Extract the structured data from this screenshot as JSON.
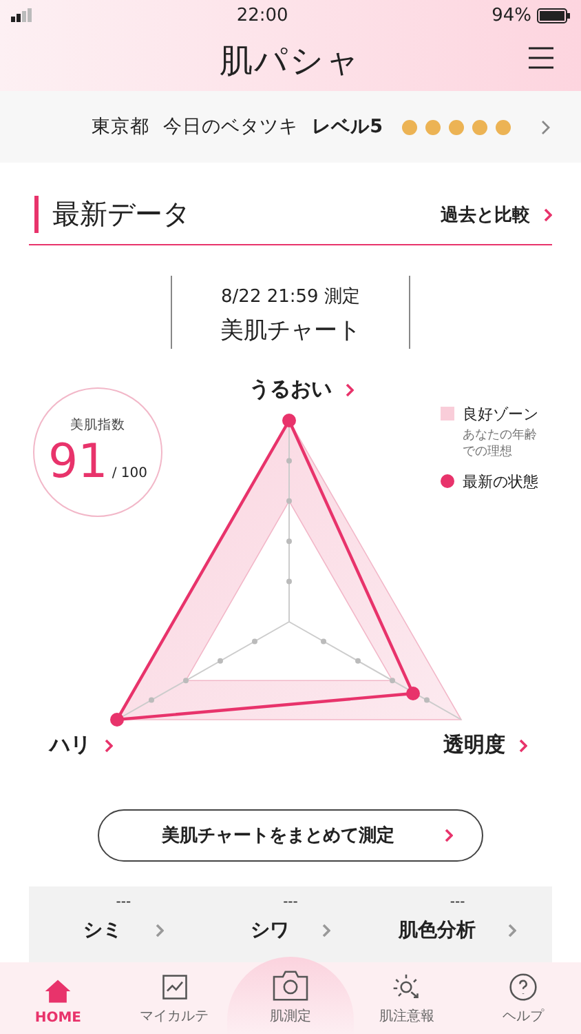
{
  "status_bar": {
    "time": "22:00",
    "battery": "94%"
  },
  "header": {
    "logo": "肌パシャ"
  },
  "weather": {
    "region": "東京都",
    "label": "今日のベタツキ",
    "level": "レベル5",
    "stars": 5
  },
  "section": {
    "title": "最新データ",
    "link": "過去と比較"
  },
  "measurement": {
    "date": "8/22 21:59 測定",
    "title": "美肌チャート"
  },
  "score": {
    "label": "美肌指数",
    "value": "91",
    "max": "/ 100"
  },
  "chart": {
    "axes": [
      "うるおい",
      "透明度",
      "ハリ"
    ],
    "legend": [
      {
        "kind": "zone",
        "label": "良好ゾーン",
        "note": "あなたの年齢での理想"
      },
      {
        "kind": "dot",
        "label": "最新の状態"
      }
    ]
  },
  "measure_button": "美肌チャートをまとめて測定",
  "cards": [
    {
      "value": "---",
      "label": "シミ"
    },
    {
      "value": "---",
      "label": "シワ"
    },
    {
      "value": "---",
      "label": "肌色分析"
    }
  ],
  "tabs": [
    {
      "label": "HOME",
      "selected": true
    },
    {
      "label": "マイカルテ",
      "selected": false
    },
    {
      "label": "肌測定",
      "selected": false
    },
    {
      "label": "肌注意報",
      "selected": false
    },
    {
      "label": "ヘルプ",
      "selected": false
    }
  ]
}
